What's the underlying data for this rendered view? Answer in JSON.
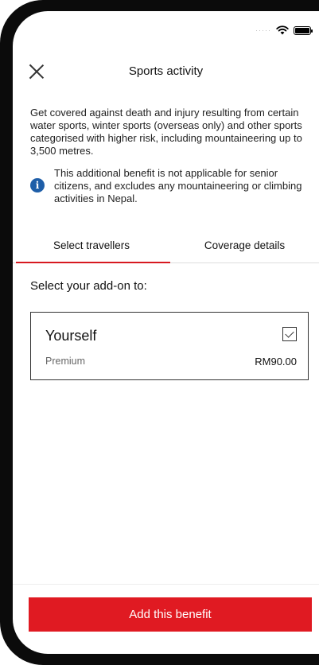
{
  "header": {
    "title": "Sports activity"
  },
  "description": "Get covered against death and injury resulting from certain water sports, winter sports (overseas only) and other sports categorised with higher risk, including mountaineering up to 3,500 metres.",
  "notice": {
    "text": "This additional benefit is not applicable for senior citizens, and excludes any mountaineering or climbing activities in Nepal."
  },
  "tabs": [
    {
      "label": "Select travellers",
      "active": true
    },
    {
      "label": "Coverage details",
      "active": false
    }
  ],
  "addon_prompt": "Select your add-on to:",
  "traveller": {
    "name": "Yourself",
    "premium_label": "Premium",
    "premium_value": "RM90.00",
    "checked": true
  },
  "action": {
    "label": "Add this benefit"
  },
  "colors": {
    "accent": "#e01a22",
    "info": "#1e5ea8"
  },
  "status_bar": {
    "signal_icon": "signal-icon",
    "wifi_icon": "wifi-icon",
    "battery_icon": "battery-icon"
  }
}
